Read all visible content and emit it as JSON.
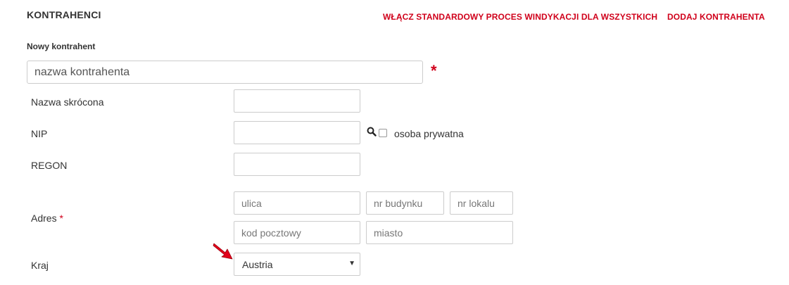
{
  "header": {
    "title": "KONTRAHENCI",
    "links": {
      "enable_collection": "WŁĄCZ STANDARDOWY PROCES WINDYKACJI DLA WSZYSTKICH",
      "add_contractor": "DODAJ KONTRAHENTA"
    }
  },
  "form": {
    "section_label": "Nowy kontrahent",
    "name": {
      "placeholder": "nazwa kontrahenta",
      "value": "",
      "required_mark": "*"
    },
    "short_name": {
      "label": "Nazwa skrócona",
      "value": ""
    },
    "nip": {
      "label": "NIP",
      "value": "",
      "lookup_icon": "search-icon"
    },
    "private_person": {
      "label": "osoba prywatna",
      "checked": false
    },
    "regon": {
      "label": "REGON",
      "value": ""
    },
    "address": {
      "label": "Adres",
      "required_mark": "*",
      "street": {
        "placeholder": "ulica"
      },
      "building_no": {
        "placeholder": "nr budynku"
      },
      "unit_no": {
        "placeholder": "nr lokalu"
      },
      "postal_code": {
        "placeholder": "kod pocztowy"
      },
      "city": {
        "placeholder": "miasto"
      }
    },
    "country": {
      "label": "Kraj",
      "selected": "Austria",
      "pointer_icon": "red-arrow-icon"
    }
  },
  "colors": {
    "accent": "#d0011b",
    "text": "#333333",
    "border": "#cccccc"
  }
}
